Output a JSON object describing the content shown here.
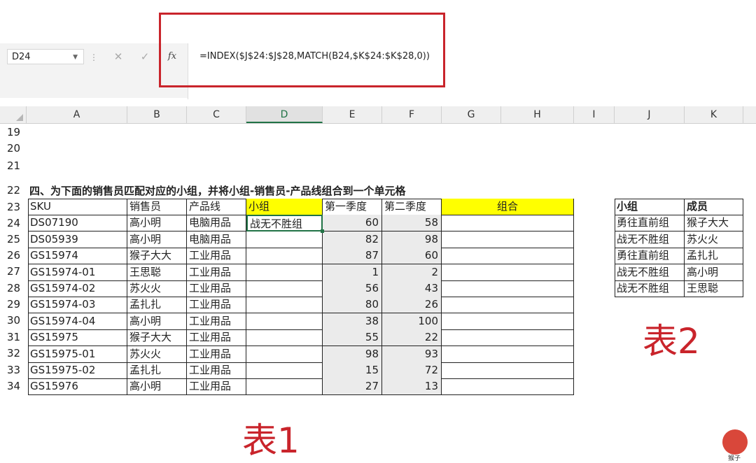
{
  "formula_bar": {
    "name_box": "D24",
    "fx_label": "fx",
    "formula": "=INDEX($J$24:$J$28,MATCH(B24,$K$24:$K$28,0))"
  },
  "columns": [
    "A",
    "B",
    "C",
    "D",
    "E",
    "F",
    "G",
    "H",
    "I",
    "J",
    "K"
  ],
  "rows": [
    "19",
    "20",
    "21",
    "22",
    "23",
    "24",
    "25",
    "26",
    "27",
    "28",
    "29",
    "30",
    "31",
    "32",
    "33",
    "34"
  ],
  "title_row22": "四、为下面的销售员匹配对应的小组，并将小组-销售员-产品线组合到一个单元格",
  "table1": {
    "headers": [
      "SKU",
      "销售员",
      "产品线",
      "小组",
      "第一季度",
      "第二季度",
      "组合"
    ],
    "rows": [
      [
        "DS07190",
        "高小明",
        "电脑用品",
        "战无不胜组",
        "60",
        "58",
        ""
      ],
      [
        "DS05939",
        "高小明",
        "电脑用品",
        "",
        "82",
        "98",
        ""
      ],
      [
        "GS15974",
        "猴子大大",
        "工业用品",
        "",
        "87",
        "60",
        ""
      ],
      [
        "GS15974-01",
        "王思聪",
        "工业用品",
        "",
        "1",
        "2",
        ""
      ],
      [
        "GS15974-02",
        "苏火火",
        "工业用品",
        "",
        "56",
        "43",
        ""
      ],
      [
        "GS15974-03",
        "孟扎扎",
        "工业用品",
        "",
        "80",
        "26",
        ""
      ],
      [
        "GS15974-04",
        "高小明",
        "工业用品",
        "",
        "38",
        "100",
        ""
      ],
      [
        "GS15975",
        "猴子大大",
        "工业用品",
        "",
        "55",
        "22",
        ""
      ],
      [
        "GS15975-01",
        "苏火火",
        "工业用品",
        "",
        "98",
        "93",
        ""
      ],
      [
        "GS15975-02",
        "孟扎扎",
        "工业用品",
        "",
        "15",
        "72",
        ""
      ],
      [
        "GS15976",
        "高小明",
        "工业用品",
        "",
        "27",
        "13",
        ""
      ]
    ],
    "caption": "表1"
  },
  "table2": {
    "headers": [
      "小组",
      "成员"
    ],
    "rows": [
      [
        "勇往直前组",
        "猴子大大"
      ],
      [
        "战无不胜组",
        "苏火火"
      ],
      [
        "勇往直前组",
        "孟扎扎"
      ],
      [
        "战无不胜组",
        "高小明"
      ],
      [
        "战无不胜组",
        "王思聪"
      ]
    ],
    "caption": "表2"
  },
  "logo_text": "猴子",
  "colors": {
    "highlight_red": "#c9242b",
    "excel_green": "#217346",
    "header_yellow": "#ffff00"
  }
}
